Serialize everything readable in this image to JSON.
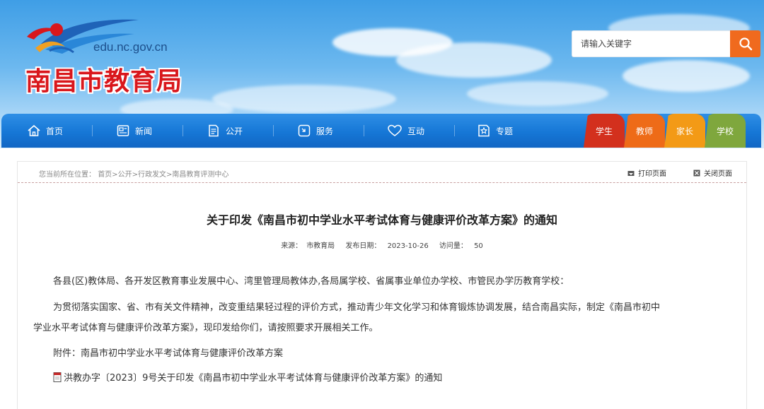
{
  "header": {
    "domain": "edu.nc.gov.cn",
    "site_title": "南昌市教育局",
    "search": {
      "placeholder": "请输入关键字",
      "button_icon": "search-icon"
    }
  },
  "nav": {
    "items": [
      {
        "label": "首页",
        "icon": "home-icon"
      },
      {
        "label": "新闻",
        "icon": "news-icon"
      },
      {
        "label": "公开",
        "icon": "document-icon"
      },
      {
        "label": "服务",
        "icon": "service-icon"
      },
      {
        "label": "互动",
        "icon": "heart-icon"
      },
      {
        "label": "专题",
        "icon": "star-icon"
      }
    ],
    "role_tabs": [
      {
        "label": "学生",
        "color": "#d3301d"
      },
      {
        "label": "教师",
        "color": "#ee6b18"
      },
      {
        "label": "家长",
        "color": "#f39a16"
      },
      {
        "label": "学校",
        "color": "#7fa73d"
      }
    ]
  },
  "breadcrumb": {
    "prefix": "您当前所在位置：",
    "path": "首页>公开>行政发文>南昌教育评测中心"
  },
  "tools": {
    "print": "打印页面",
    "close": "关闭页面"
  },
  "article": {
    "title": "关于印发《南昌市初中学业水平考试体育与健康评价改革方案》的通知",
    "meta": {
      "source_label": "来源：",
      "source": "市教育局",
      "date_label": "发布日期：",
      "date": "2023-10-26",
      "visits_label": "访问量：",
      "visits": "50"
    },
    "addressees": "各县(区)教体局、各开发区教育事业发展中心、湾里管理局教体办,各局属学校、省属事业单位办学校、市管民办学历教育学校：",
    "body_line1": "为贯彻落实国家、省、市有关文件精神，改变重结果轻过程的评价方式，推动青少年文化学习和体育锻炼协调发展，结合南昌实际，制定《南昌市初中",
    "body_line2": "学业水平考试体育与健康评价改革方案》，现印发给你们，请按照要求开展相关工作。",
    "attachment_label": "附件：南昌市初中学业水平考试体育与健康评价改革方案",
    "attachment_link": "洪教办字〔2023〕9号关于印发《南昌市初中学业水平考试体育与健康评价改革方案》的通知"
  }
}
